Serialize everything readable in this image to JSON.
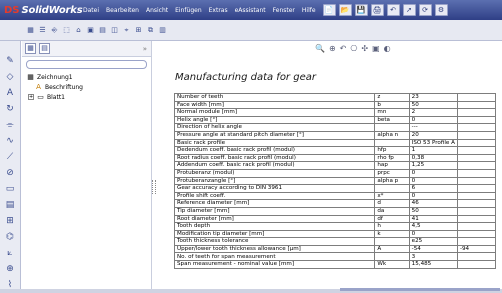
{
  "app": {
    "name": "SolidWorks",
    "logo_mark": "DS"
  },
  "menu": [
    "Datei",
    "Bearbeiten",
    "Ansicht",
    "Einfügen",
    "Extras",
    "eAssistant",
    "Fenster",
    "Hilfe"
  ],
  "toolbar_icons": [
    "new-document-icon",
    "open-icon",
    "save-icon",
    "print-icon",
    "undo-icon",
    "select-icon",
    "rebuild-icon",
    "options-icon"
  ],
  "toolbar_glyphs": [
    "📄",
    "📂",
    "💾",
    "🖨",
    "↶",
    "➚",
    "⟳",
    "⚙"
  ],
  "toolbar2_glyphs": [
    "▦",
    "☰",
    "⎆",
    "⬚",
    "⌂",
    "▣",
    "▤",
    "◫",
    "⌖",
    "⊞",
    "⧉",
    "▥",
    "⊡",
    "▦",
    "⊟",
    "⌗"
  ],
  "left_strip_glyphs": [
    "✎",
    "◇",
    "A",
    "↻",
    "⌯",
    "∿",
    "⟋",
    "⊘",
    "▭",
    "▤",
    "⊞",
    "⌬",
    "⟀",
    "⊕",
    "⌇"
  ],
  "tree": {
    "root": "Zeichnung1",
    "child1": "Beschriftung",
    "child2": "Blatt1"
  },
  "document": {
    "title": "Manufacturing data for gear",
    "rows": [
      {
        "label": "Number of teeth",
        "symbol": "z",
        "value": "23",
        "extra": ""
      },
      {
        "label": "Face width [mm]",
        "symbol": "b",
        "value": "50",
        "extra": ""
      },
      {
        "label": "Normal module [mm]",
        "symbol": "mn",
        "value": "2",
        "extra": ""
      },
      {
        "label": "Helix angle [°]",
        "symbol": "beta",
        "value": "0",
        "extra": ""
      },
      {
        "label": "Direction of helix angle",
        "symbol": "",
        "value": "---",
        "extra": ""
      },
      {
        "label": "Pressure angle at standard pitch diameter [°]",
        "symbol": "alpha n",
        "value": "20",
        "extra": ""
      },
      {
        "label": "Basic rack profile",
        "symbol": "",
        "value": "ISO 53 Profile A",
        "extra": ""
      },
      {
        "label": "Dedendum coeff. basic rack profil (modul)",
        "symbol": "hfp",
        "value": "1",
        "extra": ""
      },
      {
        "label": "Root radius coeff. basic rack profil (modul)",
        "symbol": "rho fp",
        "value": "0,38",
        "extra": ""
      },
      {
        "label": "Addendum coeff. basic rack profil (modul)",
        "symbol": "hap",
        "value": "1,25",
        "extra": ""
      },
      {
        "label": "Protuberanz (modul)",
        "symbol": "prpc",
        "value": "0",
        "extra": ""
      },
      {
        "label": "Protuberanzangle [°]",
        "symbol": "alpha p",
        "value": "0",
        "extra": ""
      },
      {
        "label": "Gear accuracy according to DIN 3961",
        "symbol": "",
        "value": "6",
        "extra": ""
      },
      {
        "label": "Profile shift coeff.",
        "symbol": "x*",
        "value": "0",
        "extra": ""
      },
      {
        "label": "Reference diameter [mm]",
        "symbol": "d",
        "value": "46",
        "extra": ""
      },
      {
        "label": "Tip diameter [mm]",
        "symbol": "da",
        "value": "50",
        "extra": ""
      },
      {
        "label": "Root diameter [mm]",
        "symbol": "df",
        "value": "41",
        "extra": ""
      },
      {
        "label": "Tooth depth",
        "symbol": "h",
        "value": "4,5",
        "extra": ""
      },
      {
        "label": "Modification tip diameter [mm]",
        "symbol": "k",
        "value": "0",
        "extra": ""
      },
      {
        "label": "Tooth thickness tolerance",
        "symbol": "",
        "value": "e25",
        "extra": ""
      },
      {
        "label": "Upper/lower tooth thickness allowance [µm]",
        "symbol": "A",
        "value": "-54",
        "extra": "-94"
      },
      {
        "label": "No. of teeth for span measurement",
        "symbol": "",
        "value": "3",
        "extra": ""
      },
      {
        "label": "Span measurement - nominal value [mm]",
        "symbol": "Wk",
        "value": "15,485",
        "extra": ""
      }
    ]
  },
  "colors": {
    "menubar": "#3e4f97",
    "logo_red": "#e53b2c",
    "panel_bg": "#e9ebf3"
  }
}
